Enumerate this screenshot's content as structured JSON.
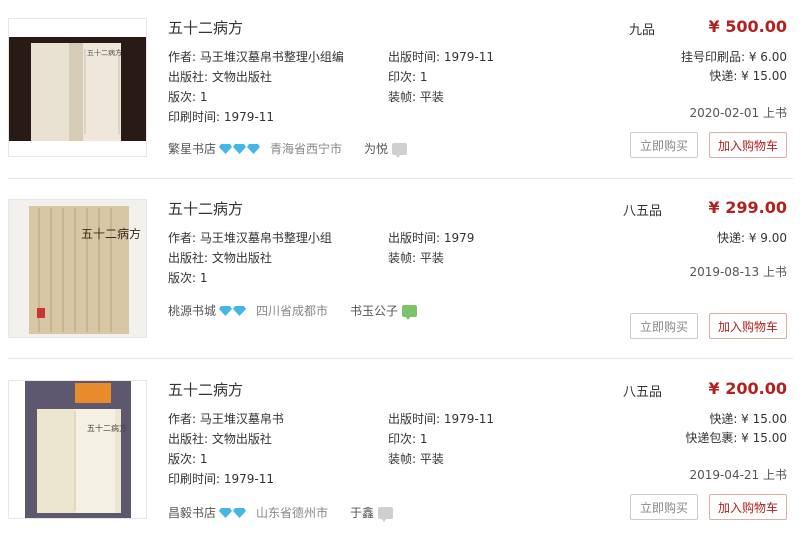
{
  "labels": {
    "author": "作者:",
    "publisher": "出版社:",
    "edition": "版次:",
    "print_time": "印刷时间:",
    "pub_time": "出版时间:",
    "impression": "印次:",
    "binding": "装帧:",
    "buy_now": "立即购买",
    "add_cart": "加入购物车"
  },
  "items": [
    {
      "title": "五十二病方",
      "grade": "九品",
      "price": "¥ 500.00",
      "author": "马王堆汉墓帛书整理小组编",
      "publisher": "文物出版社",
      "edition": "1",
      "print_time": "1979-11",
      "pub_time": "1979-11",
      "impression": "1",
      "binding": "平装",
      "fee1": "挂号印刷品: ¥ 6.00",
      "fee2": "快递: ¥ 15.00",
      "listed": "2020-02-01 上书",
      "shop": "繁星书店",
      "gems": 3,
      "location": "青海省西宁市",
      "seller": "为悦",
      "chat_color": "#cfcfcf"
    },
    {
      "title": "五十二病方",
      "grade": "八五品",
      "price": "¥ 299.00",
      "author": "马王堆汉墓帛书整理小组",
      "publisher": "文物出版社",
      "edition": "1",
      "pub_time": "1979",
      "binding": "平装",
      "fee1": "快递: ¥ 9.00",
      "listed": "2019-08-13 上书",
      "shop": "桃源书城",
      "gems": 2,
      "location": "四川省成都市",
      "seller": "书玉公子",
      "chat_color": "#7cc36a"
    },
    {
      "title": "五十二病方",
      "grade": "八五品",
      "price": "¥ 200.00",
      "author": "马王堆汉墓帛书",
      "publisher": "文物出版社",
      "edition": "1",
      "print_time": "1979-11",
      "pub_time": "1979-11",
      "impression": "1",
      "binding": "平装",
      "fee1": "快递: ¥ 15.00",
      "fee2": "快递包裹: ¥ 15.00",
      "listed": "2019-04-21 上书",
      "shop": "昌毅书店",
      "gems": 2,
      "location": "山东省德州市",
      "seller": "于鑫",
      "chat_color": "#cfcfcf"
    }
  ],
  "colors": {
    "price": "#b2211f",
    "gem": "#45b6e8"
  }
}
